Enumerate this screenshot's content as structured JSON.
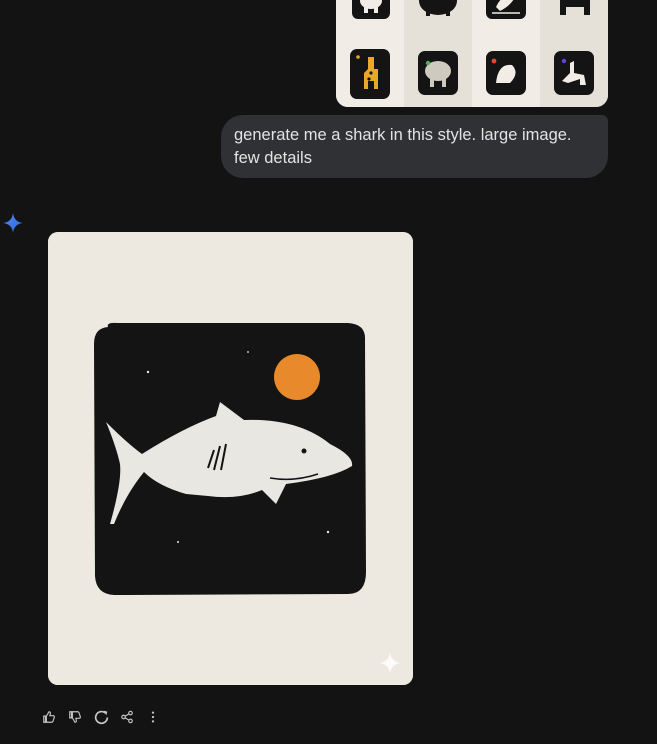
{
  "conversation": {
    "user_message": {
      "text": "generate me a shark in this style. large image. few details",
      "attachments": [
        {
          "icon": "elephant-icon"
        },
        {
          "icon": "elephant-icon"
        },
        {
          "icon": "bird-icon"
        },
        {
          "icon": "llama-icon"
        },
        {
          "icon": "giraffe-icon"
        },
        {
          "icon": "elephant-icon"
        },
        {
          "icon": "bird-icon"
        },
        {
          "icon": "llama-icon"
        }
      ]
    },
    "response": {
      "avatar_icon": "gemini-star-icon",
      "image": {
        "subject": "shark-icon",
        "watermark_icon": "sparkle-icon"
      },
      "actions": [
        {
          "icon": "thumbs-up-icon"
        },
        {
          "icon": "thumbs-down-icon"
        },
        {
          "icon": "regenerate-icon"
        },
        {
          "icon": "share-icon"
        },
        {
          "icon": "more-vert-icon"
        }
      ]
    }
  },
  "colors": {
    "background": "#131314",
    "bubble": "#303134",
    "text": "#e3e3e3",
    "accent": "#4285f4",
    "art_paper": "#ede9e0",
    "art_ink": "#141414",
    "art_sun": "#e8892b"
  }
}
